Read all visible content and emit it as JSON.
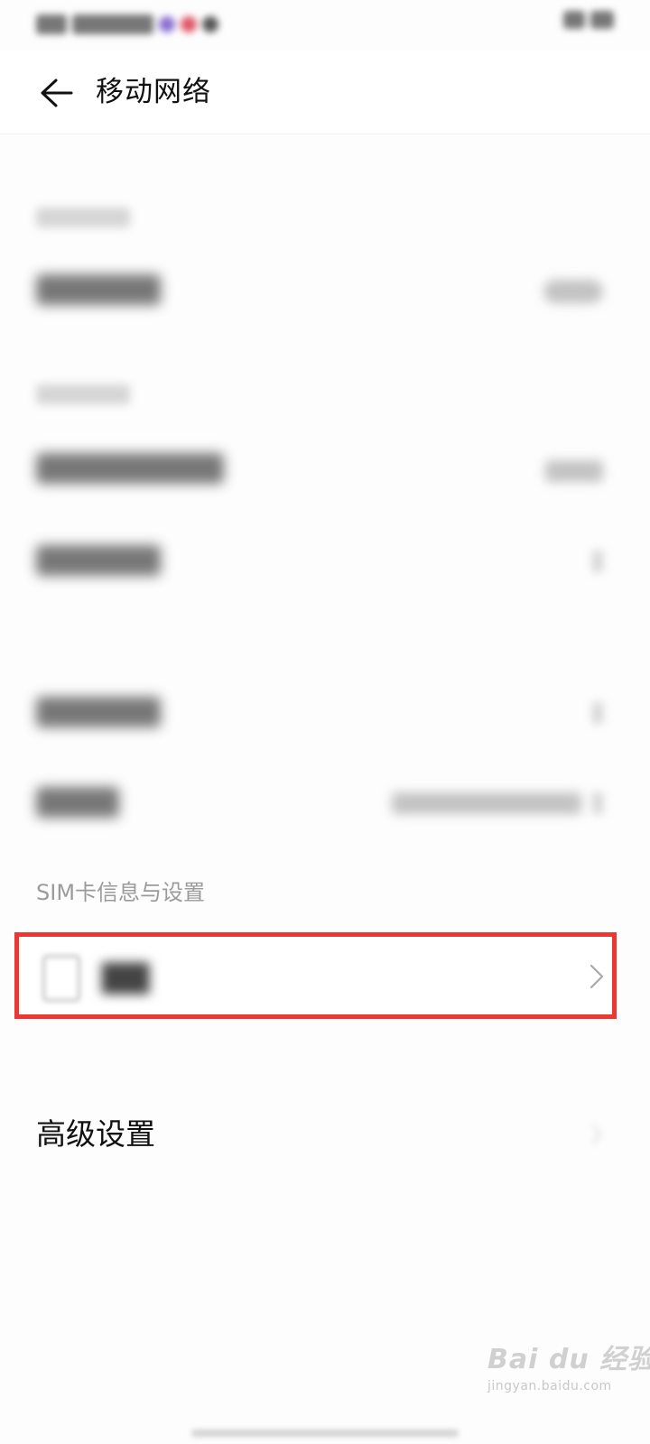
{
  "header": {
    "title": "移动网络",
    "back_icon": "arrow-left-icon"
  },
  "sim_section": {
    "label": "SIM卡信息与设置",
    "sim_icon": "sim-card-icon",
    "chevron_icon": "chevron-right-icon",
    "highlight_color": "#ee3732"
  },
  "advanced": {
    "label": "高级设置",
    "chevron_icon": "chevron-right-icon"
  },
  "watermark": {
    "logo": "Bai du 经验",
    "site": "jingyan.baidu.com"
  }
}
